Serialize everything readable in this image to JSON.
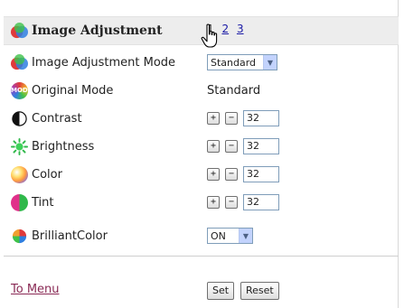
{
  "header": {
    "title": "Image Adjustment",
    "pages": {
      "current": "1",
      "p2": "2",
      "p3": "3"
    }
  },
  "rows": {
    "mode": {
      "label": "Image Adjustment Mode",
      "value": "Standard"
    },
    "original": {
      "label": "Original Mode",
      "value": "Standard",
      "icon_text": "MODE"
    },
    "contrast": {
      "label": "Contrast",
      "value": "32"
    },
    "brightness": {
      "label": "Brightness",
      "value": "32"
    },
    "color": {
      "label": "Color",
      "value": "32"
    },
    "tint": {
      "label": "Tint",
      "value": "32"
    },
    "brilliant": {
      "label": "BrilliantColor",
      "value": "ON"
    }
  },
  "controls": {
    "plus": "+",
    "minus": "−",
    "dropdown_arrow": "▼"
  },
  "footer": {
    "to_menu": "To Menu",
    "set": "Set",
    "reset": "Reset"
  },
  "icons": {
    "image_adjustment": "image-adjustment-icon",
    "contrast": "contrast-icon",
    "brightness": "brightness-icon",
    "color": "color-icon",
    "tint": "tint-icon",
    "brilliant": "brilliantcolor-icon",
    "cursor": "hand-cursor-icon"
  },
  "colors": {
    "link": "#1a1aa6",
    "to_menu": "#8a2a55",
    "header_bg": "#ededed"
  }
}
